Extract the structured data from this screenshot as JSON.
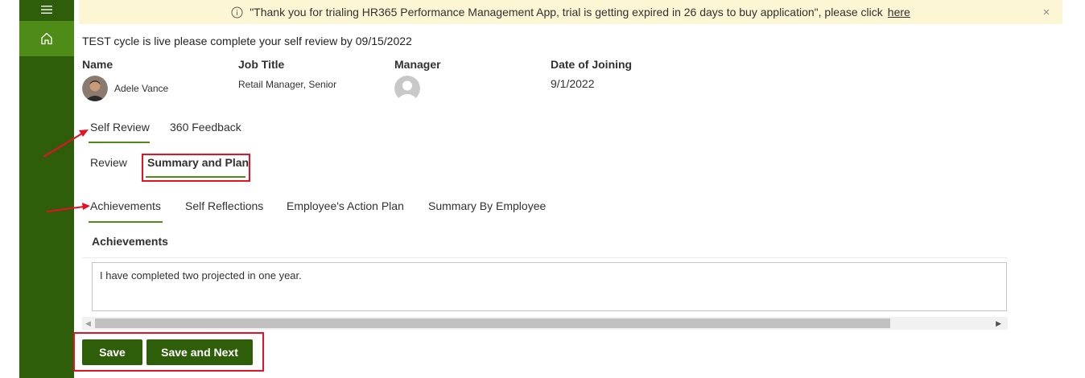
{
  "banner": {
    "message": "\"Thank you for trialing HR365 Performance Management App, trial is getting expired in 26 days to buy application\", please click",
    "link": "here",
    "close": "×"
  },
  "cycle_message": "TEST cycle is live please complete your self review by 09/15/2022",
  "employee": {
    "name_label": "Name",
    "name": "Adele Vance",
    "job_title_label": "Job Title",
    "job_title": "Retail Manager, Senior",
    "manager_label": "Manager",
    "doj_label": "Date of Joining",
    "doj": "9/1/2022"
  },
  "main_tabs": [
    "Self Review",
    "360 Feedback"
  ],
  "sub_tabs": [
    "Review",
    "Summary and Plan"
  ],
  "section_tabs": [
    "Achievements",
    "Self Reflections",
    "Employee's Action Plan",
    "Summary By Employee"
  ],
  "section": {
    "title": "Achievements",
    "text": "I have completed two projected in one year."
  },
  "buttons": {
    "save": "Save",
    "save_next": "Save and Next"
  },
  "colors": {
    "rail": "#2f5e0b",
    "rail_active": "#4f8c17",
    "accent": "#4f8c17",
    "banner_bg": "#fdf6d4",
    "annotation": "#e81123"
  },
  "icons": {
    "menu": "hamburger-icon",
    "home": "home-icon",
    "info": "info-icon",
    "close": "close-icon"
  }
}
